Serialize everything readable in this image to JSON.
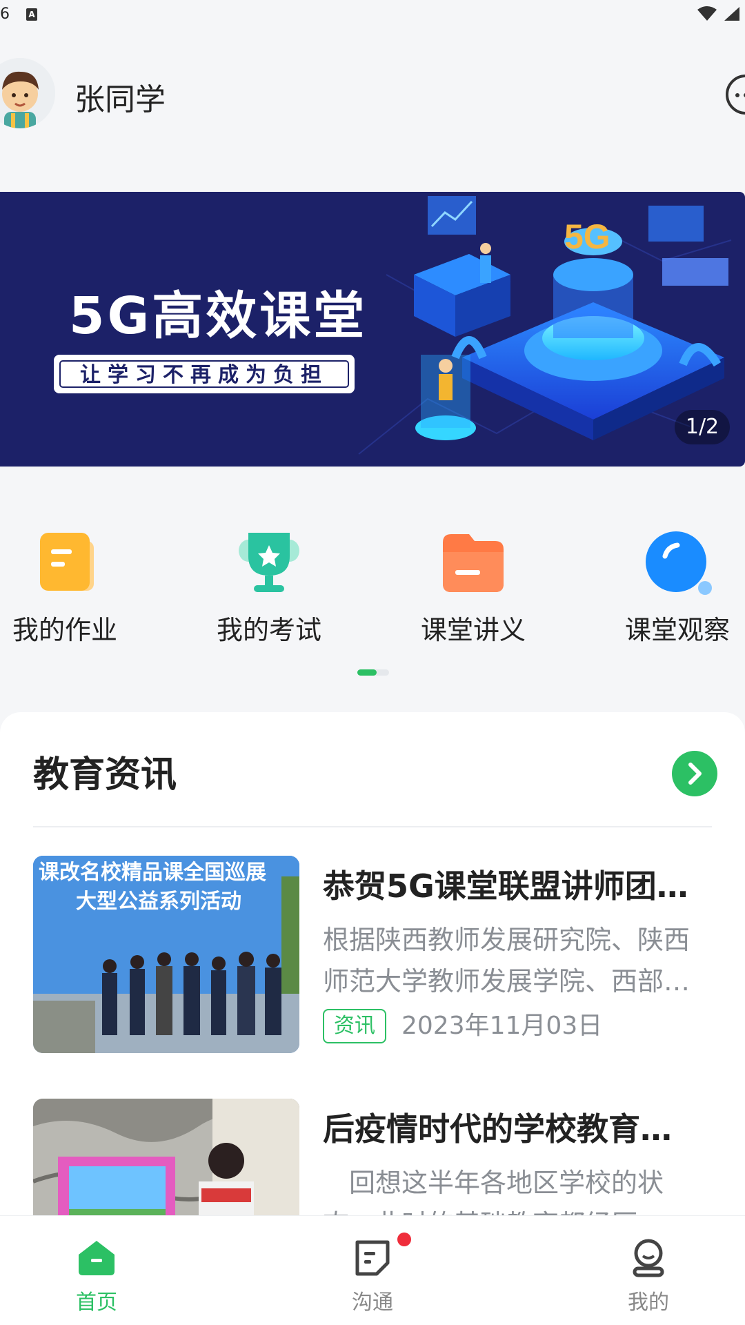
{
  "status": {
    "time": "6"
  },
  "header": {
    "username": "张同学"
  },
  "banner": {
    "title": "5G高效课堂",
    "subtitle": "让学习不再成为负担",
    "badge": "5G",
    "counter": "1/2"
  },
  "quick_menu": {
    "items": [
      {
        "label": "我的作业",
        "icon": "homework-icon",
        "color": "#ffb830"
      },
      {
        "label": "我的考试",
        "icon": "exam-trophy-icon",
        "color": "#2ac3a0"
      },
      {
        "label": "课堂讲义",
        "icon": "folder-icon",
        "color": "#ff7a45"
      },
      {
        "label": "课堂观察",
        "icon": "observe-icon",
        "color": "#1a8cff"
      }
    ]
  },
  "news": {
    "section_title": "教育资讯",
    "items": [
      {
        "title": "恭贺5G课堂联盟讲师团…",
        "description": "根据陕西教师发展研究院、陕西师范大学教师发展学院、西部…",
        "tag": "资讯",
        "date": "2023年11月03日",
        "thumb_caption_1": "课改名校精品课全国巡展",
        "thumb_caption_2": "大型公益系列活动"
      },
      {
        "title": "后疫情时代的学校教育…",
        "description": "　回想这半年各地区学校的状态，此时的基础教育都经历…",
        "tag": "",
        "date": ""
      }
    ]
  },
  "bottom_nav": {
    "items": [
      {
        "label": "首页",
        "icon": "home-icon",
        "active": true
      },
      {
        "label": "沟通",
        "icon": "chat-icon",
        "active": false
      },
      {
        "label": "我的",
        "icon": "profile-icon",
        "active": false
      }
    ]
  },
  "colors": {
    "accent": "#2cc064",
    "banner_bg": "#1c2168",
    "badge_red": "#ef2d3b"
  }
}
